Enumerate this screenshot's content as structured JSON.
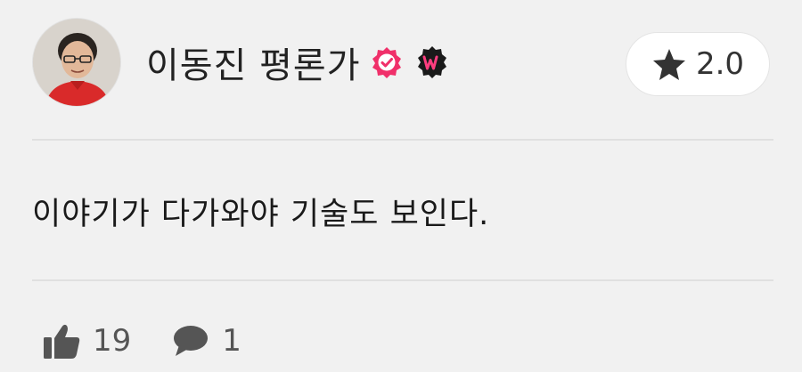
{
  "review": {
    "author_name": "이동진 평론가",
    "rating": "2.0",
    "comment": "이야기가 다가와야 기술도 보인다.",
    "likes": "19",
    "comments": "1"
  },
  "colors": {
    "background": "#f1f1f1",
    "verified_badge": "#f0306a",
    "brand_badge_bg": "#1a1a1a",
    "brand_badge_text": "#ff3d7f",
    "icon_gray": "#555555"
  },
  "icons": {
    "verified": "verified-check-icon",
    "brand": "w-brand-badge-icon",
    "rating": "star-icon",
    "like": "thumbs-up-icon",
    "comment": "speech-bubble-icon"
  }
}
